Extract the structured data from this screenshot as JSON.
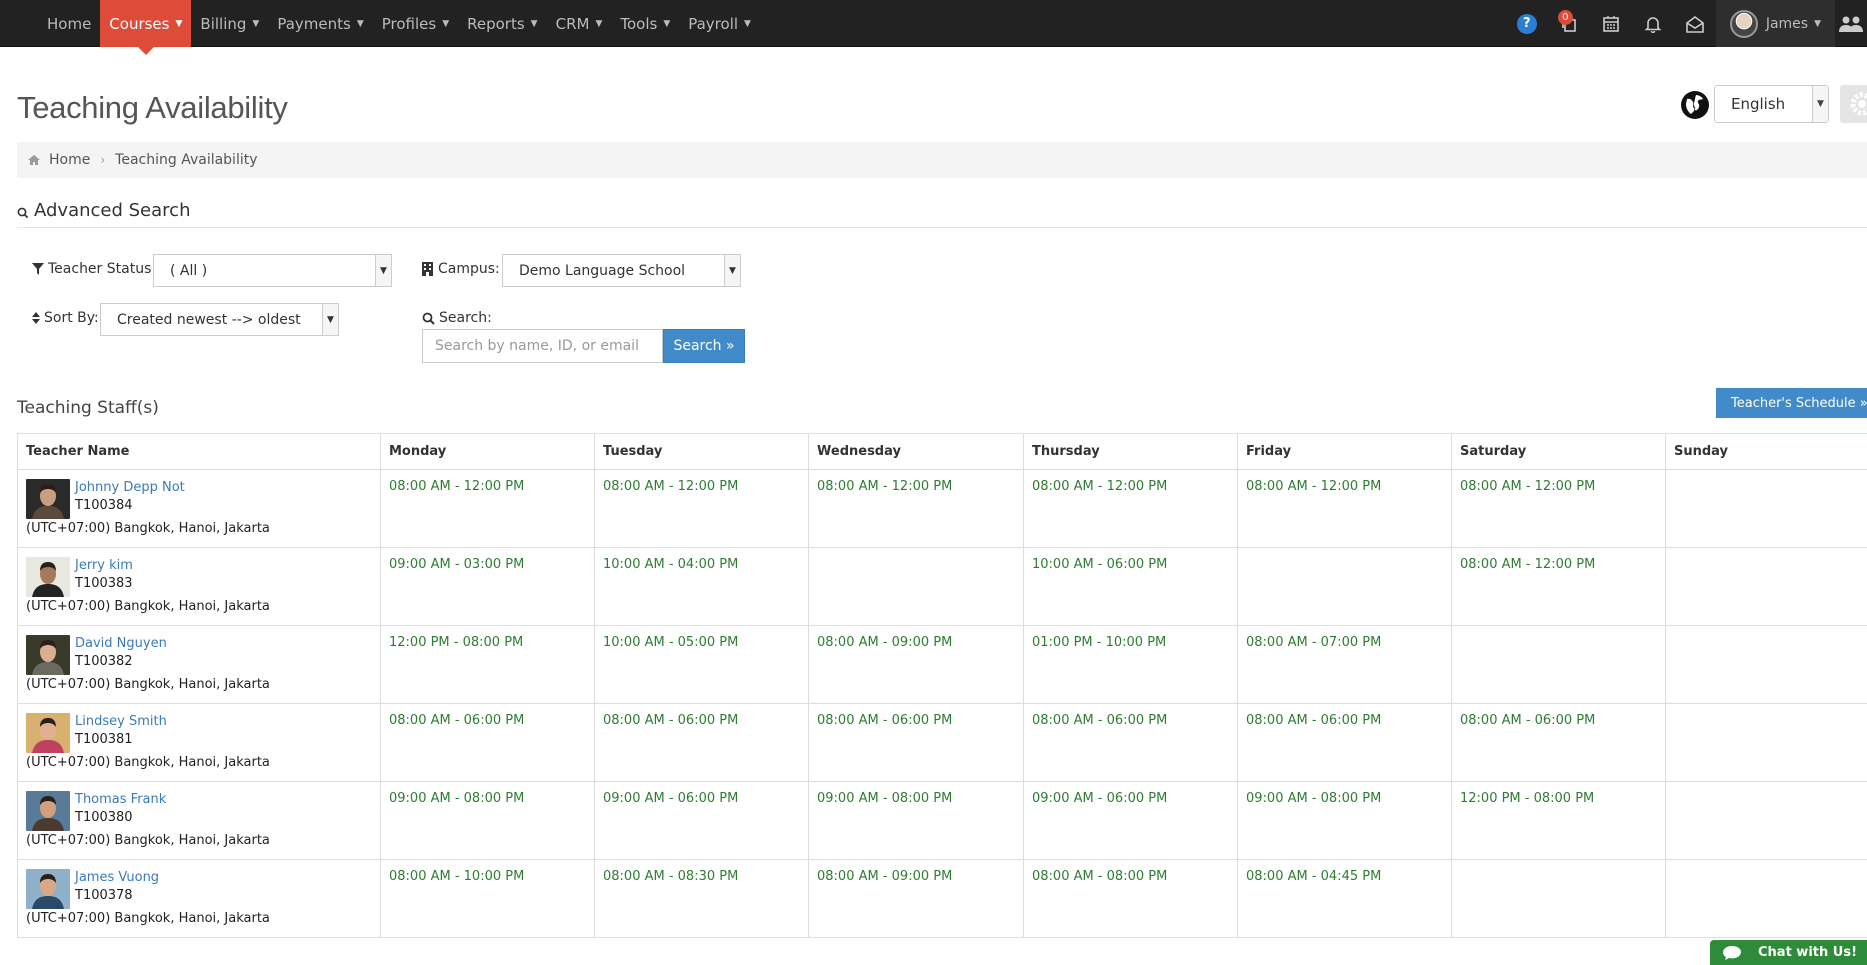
{
  "nav": {
    "items": [
      {
        "label": "Home",
        "caret": false,
        "active": false
      },
      {
        "label": "Courses",
        "caret": true,
        "active": true
      },
      {
        "label": "Billing",
        "caret": true,
        "active": false
      },
      {
        "label": "Payments",
        "caret": true,
        "active": false
      },
      {
        "label": "Profiles",
        "caret": true,
        "active": false
      },
      {
        "label": "Reports",
        "caret": true,
        "active": false
      },
      {
        "label": "CRM",
        "caret": true,
        "active": false
      },
      {
        "label": "Tools",
        "caret": true,
        "active": false
      },
      {
        "label": "Payroll",
        "caret": true,
        "active": false
      }
    ],
    "help_label": "?",
    "notification_count": "0",
    "user_name": "James"
  },
  "page": {
    "title": "Teaching Availability",
    "language": "English"
  },
  "breadcrumb": {
    "home": "Home",
    "current": "Teaching Availability"
  },
  "search": {
    "section_title": "Advanced Search",
    "teacher_status_label": "Teacher Status:",
    "teacher_status_value": "( All )",
    "campus_label": "Campus:",
    "campus_value": "Demo Language School",
    "sort_label": "Sort By:",
    "sort_value": "Created newest --> oldest",
    "search_label": "Search:",
    "search_placeholder": "Search by name, ID, or email",
    "search_button": "Search »"
  },
  "staff": {
    "title": "Teaching Staff(s)",
    "schedule_button": "Teacher's Schedule »",
    "columns": [
      "Teacher Name",
      "Monday",
      "Tuesday",
      "Wednesday",
      "Thursday",
      "Friday",
      "Saturday",
      "Sunday"
    ],
    "rows": [
      {
        "name": "Johnny Depp Not",
        "id": "T100384",
        "tz": "(UTC+07:00) Bangkok, Hanoi, Jakarta",
        "slots": [
          "08:00 AM - 12:00 PM",
          "08:00 AM - 12:00 PM",
          "08:00 AM - 12:00 PM",
          "08:00 AM - 12:00 PM",
          "08:00 AM - 12:00 PM",
          "08:00 AM - 12:00 PM",
          ""
        ]
      },
      {
        "name": "Jerry kim",
        "id": "T100383",
        "tz": "(UTC+07:00) Bangkok, Hanoi, Jakarta",
        "slots": [
          "09:00 AM - 03:00 PM",
          "10:00 AM - 04:00 PM",
          "",
          "10:00 AM - 06:00 PM",
          "",
          "08:00 AM - 12:00 PM",
          ""
        ]
      },
      {
        "name": "David Nguyen",
        "id": "T100382",
        "tz": "(UTC+07:00) Bangkok, Hanoi, Jakarta",
        "slots": [
          "12:00 PM - 08:00 PM",
          "10:00 AM - 05:00 PM",
          "08:00 AM - 09:00 PM",
          "01:00 PM - 10:00 PM",
          "08:00 AM - 07:00 PM",
          "",
          ""
        ]
      },
      {
        "name": "Lindsey Smith",
        "id": "T100381",
        "tz": "(UTC+07:00) Bangkok, Hanoi, Jakarta",
        "slots": [
          "08:00 AM - 06:00 PM",
          "08:00 AM - 06:00 PM",
          "08:00 AM - 06:00 PM",
          "08:00 AM - 06:00 PM",
          "08:00 AM - 06:00 PM",
          "08:00 AM - 06:00 PM",
          ""
        ]
      },
      {
        "name": "Thomas Frank",
        "id": "T100380",
        "tz": "(UTC+07:00) Bangkok, Hanoi, Jakarta",
        "slots": [
          "09:00 AM - 08:00 PM",
          "09:00 AM - 06:00 PM",
          "09:00 AM - 08:00 PM",
          "09:00 AM - 06:00 PM",
          "09:00 AM - 08:00 PM",
          "12:00 PM - 08:00 PM",
          ""
        ]
      },
      {
        "name": "James Vuong",
        "id": "T100378",
        "tz": "(UTC+07:00) Bangkok, Hanoi, Jakarta",
        "slots": [
          "08:00 AM - 10:00 PM",
          "08:00 AM - 08:30 PM",
          "08:00 AM - 09:00 PM",
          "08:00 AM - 08:00 PM",
          "08:00 AM - 04:45 PM",
          "",
          ""
        ]
      }
    ]
  },
  "chat": {
    "label": "Chat with Us!"
  },
  "colors": {
    "accent": "#dd4b39",
    "primary": "#428bca",
    "slot_green": "#2e7d32",
    "link": "#3a7ab8"
  }
}
